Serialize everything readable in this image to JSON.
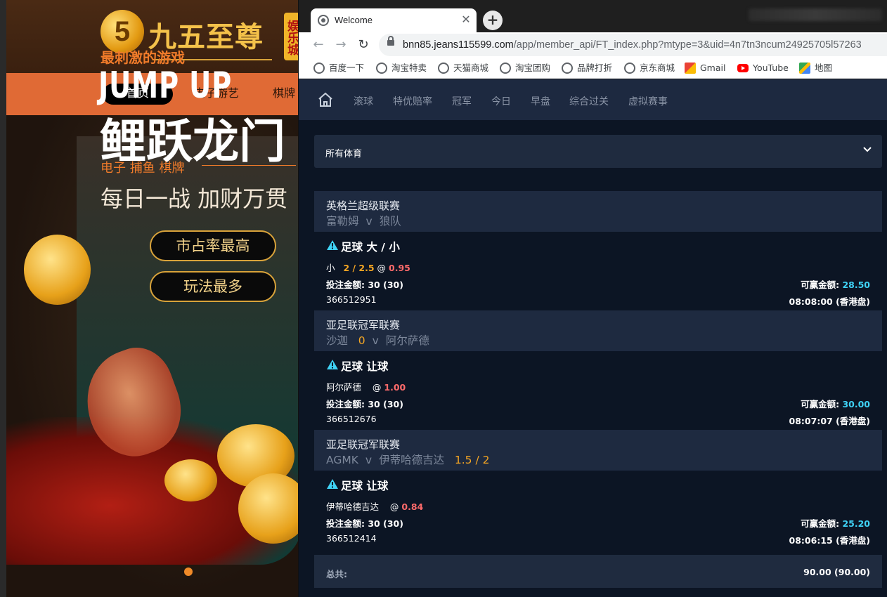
{
  "background_site": {
    "logo_mark": "5",
    "logo_name": "九五至尊",
    "logo_badge": "娱乐城",
    "nav": {
      "home": "首页",
      "games": "电子游艺",
      "cards": "棋牌"
    },
    "banner": {
      "kicker": "最刺激的游戏",
      "headline_en": "JUMP UP",
      "headline_cn": "鲤跃龙门",
      "tags": "电子 捕鱼 棋牌",
      "slogan": "每日一战 加财万贯",
      "buttons": [
        "市占率最高",
        "玩法最多"
      ]
    },
    "colors": {
      "nav_bg": "#e06a35",
      "accent": "#f07b2a"
    }
  },
  "browser": {
    "tab_title": "Welcome",
    "url_host": "bnn85.jeans115599.com",
    "url_path": "/app/member_api/FT_index.php?mtype=3&uid=4n7tn3ncum24925705l57263",
    "bookmarks": [
      "百度一下",
      "淘宝特卖",
      "天猫商城",
      "淘宝团购",
      "品牌打折",
      "京东商城",
      "Gmail",
      "YouTube",
      "地图"
    ]
  },
  "app": {
    "nav": [
      "滚球",
      "特优赔率",
      "冠军",
      "今日",
      "早盘",
      "综合过关",
      "虚拟赛事"
    ],
    "sport_filter": "所有体育",
    "bets": [
      {
        "league": "英格兰超级联赛",
        "home": "富勒姆",
        "home_line": "",
        "vs": "v",
        "away": "狼队",
        "away_line": "",
        "bet_type": "足球 大 / 小",
        "selection": "小",
        "line": "2 / 2.5",
        "odds": "0.95",
        "stake_label": "投注金额:",
        "stake": "30 (30)",
        "win_label": "可赢金额:",
        "win": "28.50",
        "ticket": "366512951",
        "time": "08:08:00 (香港盘)"
      },
      {
        "league": "亚足联冠军联赛",
        "home": "沙迦",
        "home_line": "0",
        "vs": "v",
        "away": "阿尔萨德",
        "away_line": "",
        "bet_type": "足球 让球",
        "selection": "阿尔萨德",
        "line": "",
        "odds": "1.00",
        "stake_label": "投注金额:",
        "stake": "30 (30)",
        "win_label": "可赢金额:",
        "win": "30.00",
        "ticket": "366512676",
        "time": "08:07:07 (香港盘)"
      },
      {
        "league": "亚足联冠军联赛",
        "home": "AGMK",
        "home_line": "",
        "vs": "v",
        "away": "伊蒂哈德吉达",
        "away_line": "1.5 / 2",
        "bet_type": "足球 让球",
        "selection": "伊蒂哈德吉达",
        "line": "",
        "odds": "0.84",
        "stake_label": "投注金额:",
        "stake": "30 (30)",
        "win_label": "可赢金额:",
        "win": "25.20",
        "ticket": "366512414",
        "time": "08:06:15 (香港盘)"
      }
    ],
    "total_label": "总共:",
    "total_value": "90.00 (90.00)",
    "colors": {
      "nav_bg": "#1d2940",
      "page_bg": "#0c1524",
      "line_hl": "#f5a623",
      "odds": "#ff6b6b",
      "win": "#3fd2f5",
      "warn": "#3fd2f5"
    }
  }
}
